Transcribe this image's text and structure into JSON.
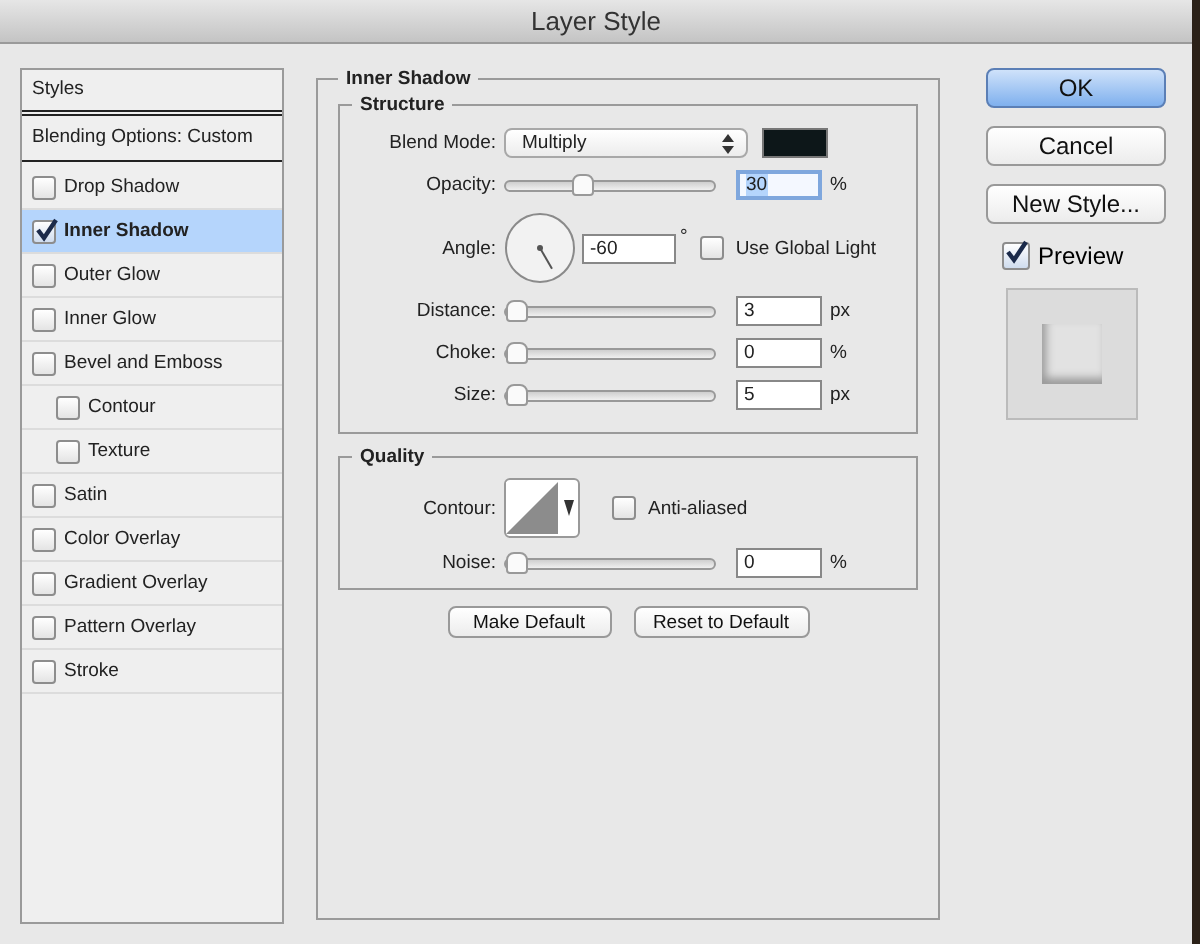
{
  "window": {
    "title": "Layer Style"
  },
  "styles_panel": {
    "header": "Styles",
    "blending_options": "Blending Options: Custom",
    "items": [
      {
        "label": "Drop Shadow",
        "checked": false,
        "selected": false
      },
      {
        "label": "Inner Shadow",
        "checked": true,
        "selected": true
      },
      {
        "label": "Outer Glow",
        "checked": false,
        "selected": false
      },
      {
        "label": "Inner Glow",
        "checked": false,
        "selected": false
      },
      {
        "label": "Bevel and Emboss",
        "checked": false,
        "selected": false,
        "children": [
          {
            "label": "Contour",
            "checked": false,
            "selected": false
          },
          {
            "label": "Texture",
            "checked": false,
            "selected": false
          }
        ]
      },
      {
        "label": "Satin",
        "checked": false,
        "selected": false
      },
      {
        "label": "Color Overlay",
        "checked": false,
        "selected": false
      },
      {
        "label": "Gradient Overlay",
        "checked": false,
        "selected": false
      },
      {
        "label": "Pattern Overlay",
        "checked": false,
        "selected": false
      },
      {
        "label": "Stroke",
        "checked": false,
        "selected": false
      }
    ]
  },
  "effect": {
    "title": "Inner Shadow",
    "structure": {
      "title": "Structure",
      "rows": [
        {
          "kind": "blend",
          "label": "Blend Mode:",
          "value": "Multiply",
          "color": "#0d1719"
        },
        {
          "kind": "slider",
          "label": "Opacity:",
          "level": 0.34,
          "value": "30",
          "unit": "%",
          "focused": true
        },
        {
          "kind": "angle",
          "label": "Angle:",
          "value": "-60",
          "unit": "°",
          "option": "Use Global Light",
          "checked": false
        },
        {
          "kind": "slider",
          "label": "Distance:",
          "level": 0.0,
          "value": "3",
          "unit": "px",
          "focused": false
        },
        {
          "kind": "slider",
          "label": "Choke:",
          "level": 0.0,
          "value": "0",
          "unit": "%",
          "focused": false
        },
        {
          "kind": "slider",
          "label": "Size:",
          "level": 0.0,
          "value": "5",
          "unit": "px",
          "focused": false
        }
      ]
    },
    "quality": {
      "title": "Quality",
      "rows": [
        {
          "kind": "contour",
          "label": "Contour:",
          "option": "Anti-aliased",
          "checked": false
        },
        {
          "kind": "slider",
          "label": "Noise:",
          "level": 0.0,
          "value": "0",
          "unit": "%",
          "focused": false
        }
      ]
    },
    "buttons": [
      "Make Default",
      "Reset to Default"
    ]
  },
  "actions": {
    "buttons": [
      {
        "label": "OK",
        "default": true
      },
      {
        "label": "Cancel",
        "default": false
      },
      {
        "label": "New Style...",
        "default": false
      }
    ],
    "preview": {
      "label": "Preview",
      "checked": true
    }
  }
}
